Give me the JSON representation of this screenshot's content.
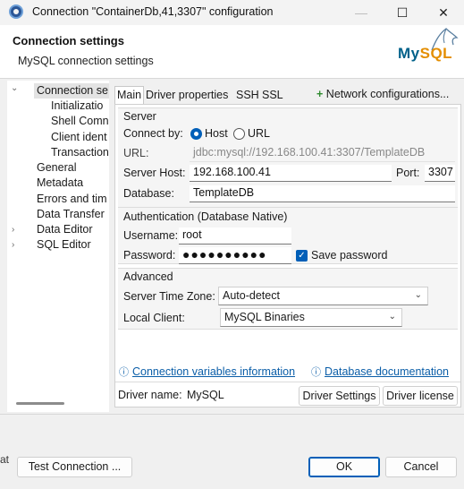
{
  "window": {
    "title": "Connection \"ContainerDb,41,3307\" configuration",
    "minimize": "—",
    "maximize": "☐",
    "close": "✕"
  },
  "header": {
    "title": "Connection settings",
    "subtitle": "MySQL connection settings",
    "logo_my": "My",
    "logo_sql": "SQL"
  },
  "tree": {
    "items": [
      {
        "label": "Connection se",
        "twisty": "⌄",
        "selected": true
      },
      {
        "label": "Initializatio"
      },
      {
        "label": "Shell Comn"
      },
      {
        "label": "Client ident"
      },
      {
        "label": "Transaction"
      },
      {
        "label": "General"
      },
      {
        "label": "Metadata"
      },
      {
        "label": "Errors and tim"
      },
      {
        "label": "Data Transfer"
      },
      {
        "label": "Data Editor",
        "twisty": "›"
      },
      {
        "label": "SQL Editor",
        "twisty": "›"
      }
    ]
  },
  "tabs": [
    {
      "label": "Main",
      "active": true
    },
    {
      "label": "Driver properties"
    },
    {
      "label": "SSH"
    },
    {
      "label": "SSL"
    }
  ],
  "network_configurations": {
    "plus": "+",
    "label": "Network configurations..."
  },
  "server": {
    "group_title": "Server",
    "connect_by_label": "Connect by:",
    "host_option": "Host",
    "url_option": "URL",
    "url_label": "URL:",
    "url_value": "jdbc:mysql://192.168.100.41:3307/TemplateDB",
    "host_label": "Server Host:",
    "host_value": "192.168.100.41",
    "port_label": "Port:",
    "port_value": "3307",
    "database_label": "Database:",
    "database_value": "TemplateDB"
  },
  "auth": {
    "group_title": "Authentication (Database Native)",
    "username_label": "Username:",
    "username_value": "root",
    "password_label": "Password:",
    "password_value": "●●●●●●●●●●",
    "save_password_label": "Save password",
    "check_mark": "✓"
  },
  "advanced": {
    "group_title": "Advanced",
    "timezone_label": "Server Time Zone:",
    "timezone_value": "Auto-detect",
    "client_label": "Local Client:",
    "client_value": "MySQL Binaries",
    "chevron": "⌄"
  },
  "links": {
    "info_icon": "ⓘ",
    "connection_variables": "Connection variables information",
    "database_docs": "Database documentation"
  },
  "driver": {
    "name_label": "Driver name:",
    "name_value": "MySQL",
    "settings_button": "Driver Settings",
    "license_button": "Driver license"
  },
  "footer": {
    "test_connection": "Test Connection ...",
    "ok": "OK",
    "cancel": "Cancel",
    "edge_text": "at"
  }
}
